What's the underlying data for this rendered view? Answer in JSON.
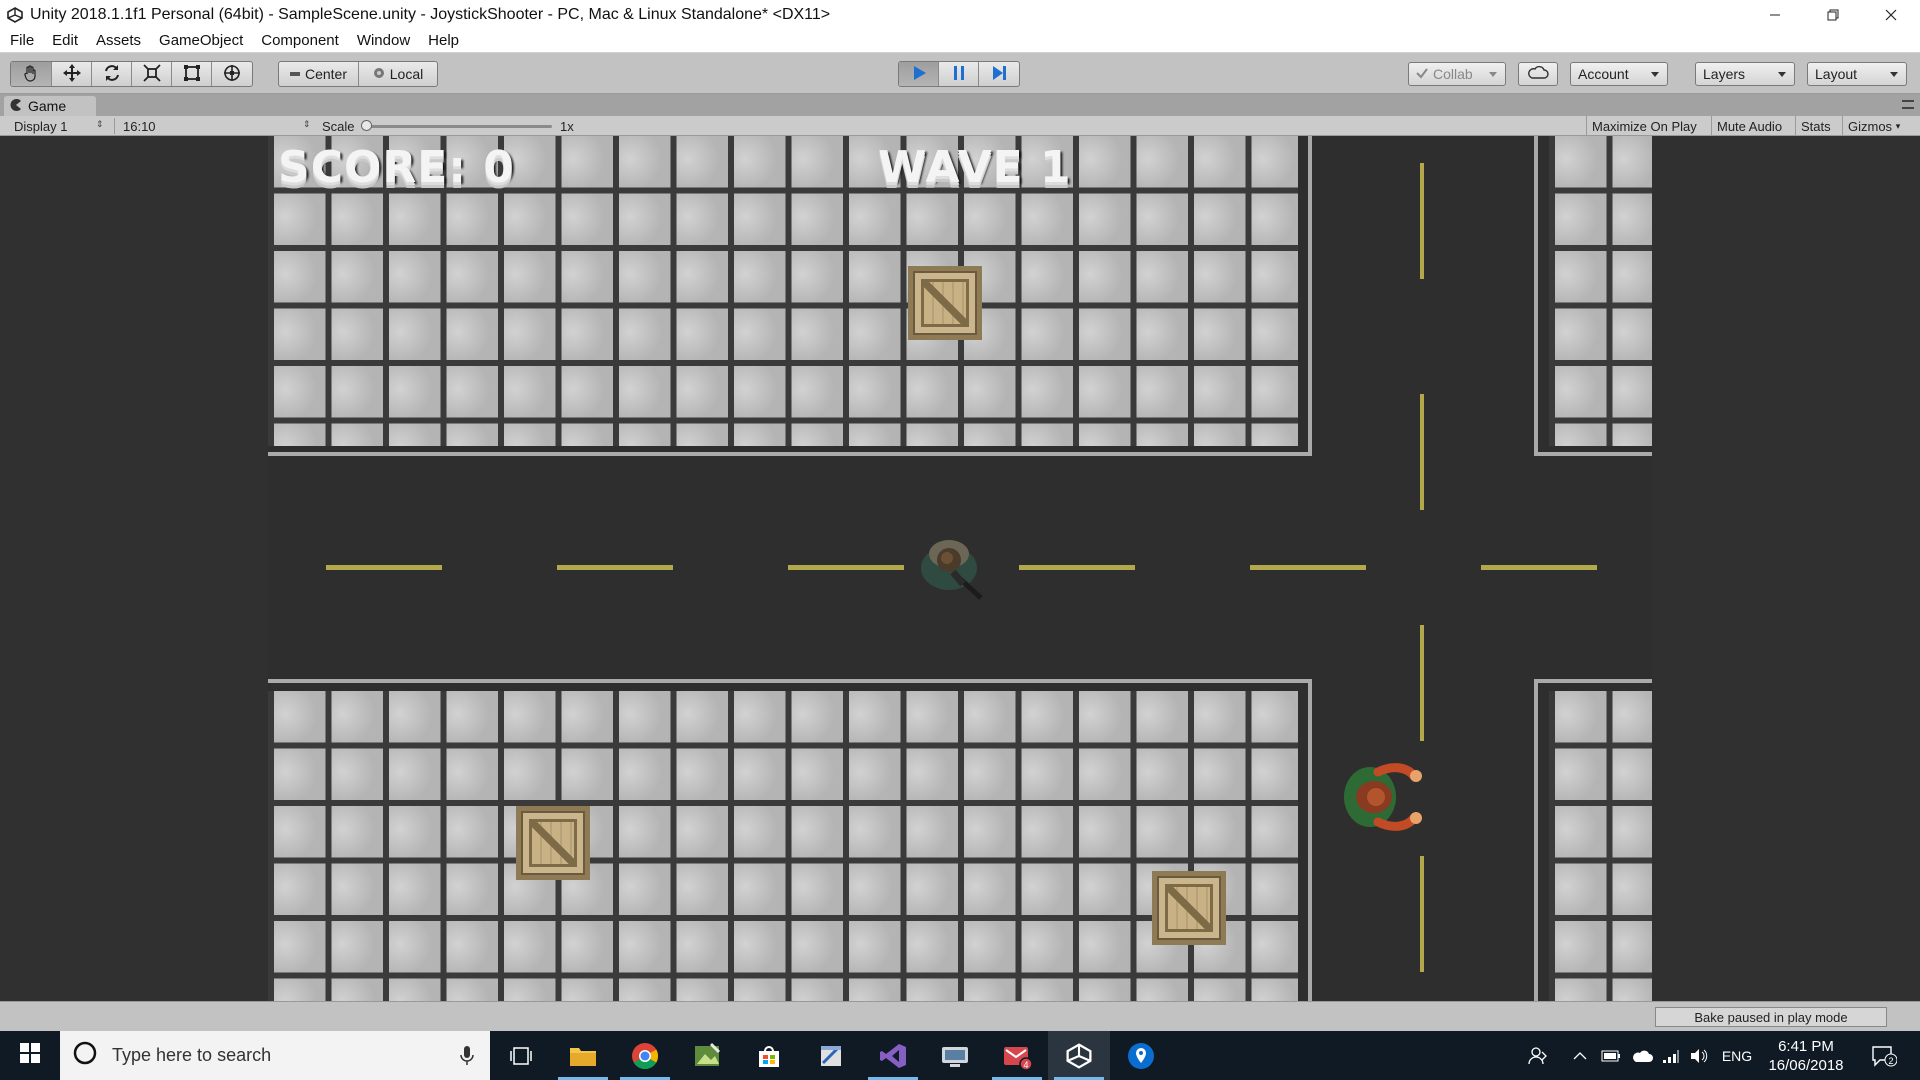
{
  "window": {
    "title": "Unity 2018.1.1f1 Personal (64bit) - SampleScene.unity - JoystickShooter - PC, Mac & Linux Standalone* <DX11>"
  },
  "menu": [
    "File",
    "Edit",
    "Assets",
    "GameObject",
    "Component",
    "Window",
    "Help"
  ],
  "toolbar": {
    "tools": [
      "hand-icon",
      "move-icon",
      "rotate-icon",
      "scale-icon",
      "rect-icon",
      "transform-icon"
    ],
    "pivot_center": "Center",
    "pivot_local": "Local",
    "collab": "Collab",
    "account": "Account",
    "layers": "Layers",
    "layout": "Layout",
    "play_state": "playing"
  },
  "game_view": {
    "tab_label": "Game",
    "display": "Display 1",
    "aspect": "16:10",
    "scale_label": "Scale",
    "scale_value": "1x",
    "maximize": "Maximize On Play",
    "mute": "Mute Audio",
    "stats": "Stats",
    "gizmos": "Gizmos"
  },
  "hud": {
    "score": "SCORE: 0",
    "wave": "WAVE 1"
  },
  "status": {
    "bake": "Bake paused in play mode"
  },
  "taskbar": {
    "search_placeholder": "Type here to search",
    "apps": [
      "task-view-icon",
      "file-explorer-icon",
      "chrome-icon",
      "image-editor-icon",
      "store-icon",
      "app-icon",
      "visual-studio-icon",
      "remote-icon",
      "mail-icon",
      "unity-icon",
      "maps-icon"
    ],
    "badge_count": "4",
    "language": "ENG",
    "time": "6:41 PM",
    "date": "16/06/2018",
    "notifications": "2"
  },
  "colors": {
    "road": "#2e2e2e",
    "lane_marking": "#b3a84c",
    "tile": "#b9b9b9",
    "play_blue": "#1f6fd1",
    "taskbar": "#101a24"
  }
}
